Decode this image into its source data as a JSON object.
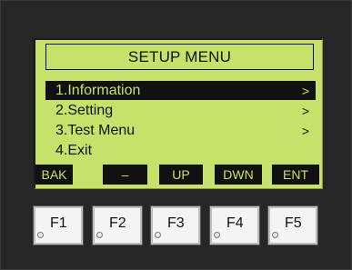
{
  "lcd": {
    "title": "SETUP MENU",
    "items": [
      {
        "label": "1.Information",
        "arrow": ">",
        "selected": true
      },
      {
        "label": "2.Setting",
        "arrow": ">",
        "selected": false
      },
      {
        "label": "3.Test Menu",
        "arrow": ">",
        "selected": false
      },
      {
        "label": "4.Exit",
        "arrow": "",
        "selected": false
      }
    ],
    "softkeys": [
      "BAK",
      "–",
      "UP",
      "DWN",
      "ENT"
    ]
  },
  "function_keys": [
    "F1",
    "F2",
    "F3",
    "F4",
    "F5"
  ],
  "colors": {
    "lcd_background": "#c7e26a",
    "lcd_ink": "#111111",
    "bezel": "#262626",
    "key_face": "#f4f4f4"
  }
}
